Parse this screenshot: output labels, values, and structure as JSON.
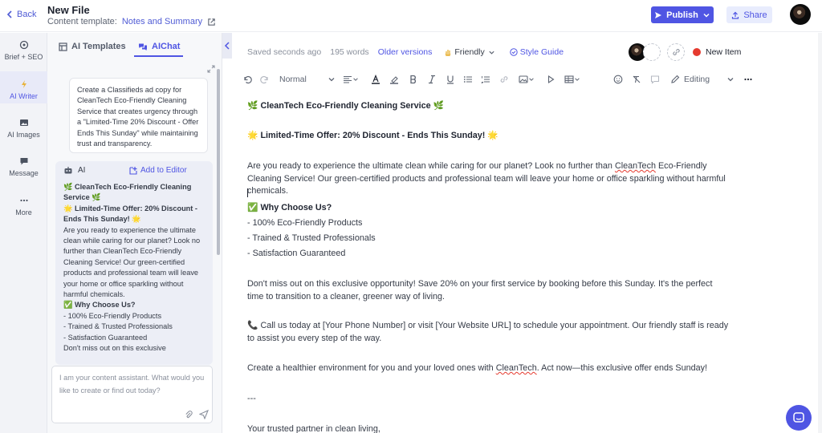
{
  "header": {
    "back_label": "Back",
    "file_title": "New File",
    "template_prefix": "Content template:",
    "template_name": "Notes and Summary",
    "publish_label": "Publish",
    "share_label": "Share"
  },
  "rail": [
    {
      "label": "Brief + SEO",
      "icon": "target-icon"
    },
    {
      "label": "AI Writer",
      "icon": "bolt-icon",
      "active": true
    },
    {
      "label": "AI Images",
      "icon": "image-icon"
    },
    {
      "label": "Message",
      "icon": "message-icon"
    },
    {
      "label": "More",
      "icon": "more-icon"
    }
  ],
  "panel": {
    "tab_templates": "AI Templates",
    "tab_chat": "AIChat",
    "prompt": "Create a Classifieds ad copy for CleanTech Eco-Friendly Cleaning Service that creates urgency through a \"Limited-Time 20% Discount - Offer Ends This Sunday\" while maintaining trust and transparency.",
    "ai_label": "AI",
    "add_to_editor": "Add to Editor",
    "ai_lines": [
      {
        "text": "🌿 CleanTech Eco-Friendly Cleaning Service 🌿",
        "bold": true
      },
      {
        "text": "🌟 Limited-Time Offer: 20% Discount - Ends This Sunday! 🌟",
        "bold": true
      },
      {
        "text": "Are you ready to experience the ultimate clean while caring for our planet? Look no further than CleanTech Eco-Friendly Cleaning Service! Our green-certified products and professional team will leave your home or office sparkling without harmful chemicals.",
        "bold": false
      },
      {
        "text": "✅ Why Choose Us?",
        "bold": true
      },
      {
        "text": "- 100% Eco-Friendly Products",
        "bold": false
      },
      {
        "text": "- Trained & Trusted Professionals",
        "bold": false
      },
      {
        "text": "- Satisfaction Guaranteed",
        "bold": false
      },
      {
        "text": "Don't miss out on this exclusive",
        "bold": false
      }
    ],
    "chat_placeholder": "I am your content assistant. What would you like to create or find out today?"
  },
  "status": {
    "saved": "Saved seconds ago",
    "words": "195 words",
    "older_versions": "Older versions",
    "tone": "Friendly",
    "style_guide": "Style Guide",
    "new_item": "New Item"
  },
  "toolbar": {
    "paragraph_style": "Normal",
    "mode": "Editing"
  },
  "document": {
    "title": "🌿 CleanTech Eco-Friendly Cleaning Service 🌿",
    "offer": "🌟 Limited-Time Offer: 20% Discount - Ends This Sunday! 🌟",
    "intro_1": "Are you ready to experience the ultimate clean while caring for our planet? Look no further than ",
    "intro_brand": "CleanTech",
    "intro_2": " Eco-Friendly Cleaning Service! Our green-certified products and professional team will leave your home or office sparkling without harmful chemicals.",
    "why_heading": "✅ Why Choose Us?",
    "bullets": [
      "- 100% Eco-Friendly Products",
      "- Trained & Trusted Professionals",
      "- Satisfaction Guaranteed"
    ],
    "cta": "Don't miss out on this exclusive opportunity! Save 20% on your first service by booking before this Sunday. It's the perfect time to transition to a cleaner, greener way of living.",
    "call": "📞 Call us today at [Your Phone Number] or visit [Your Website URL] to schedule your appointment. Our friendly staff is ready to assist you every step of the way.",
    "closing_1": "Create a healthier environment for you and your loved ones with ",
    "closing_brand": "CleanTech",
    "closing_2": ". Act now—this exclusive offer ends Sunday!",
    "divider": "---",
    "signoff": "Your trusted partner in clean living,"
  },
  "colors": {
    "accent": "#4f55e3",
    "new_item_dot": "#e53a2f"
  }
}
